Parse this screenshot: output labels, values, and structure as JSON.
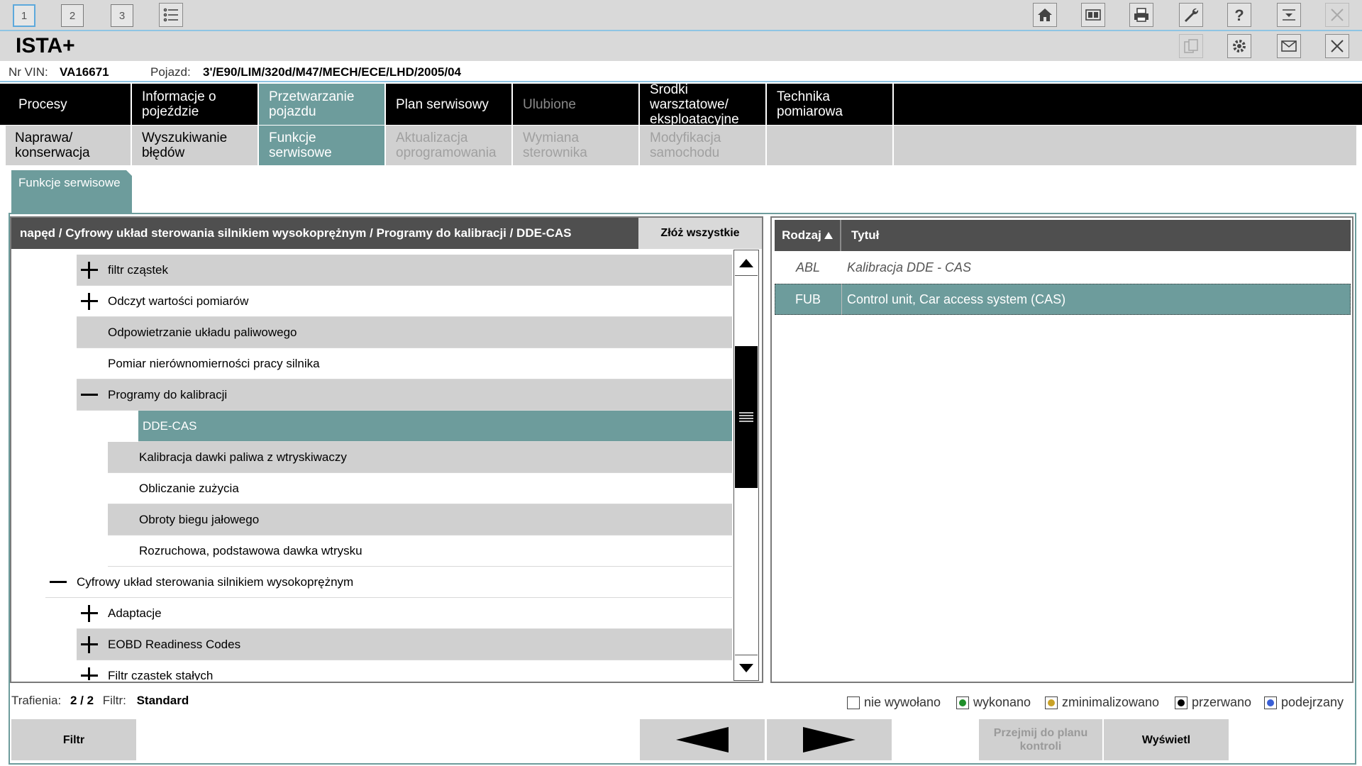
{
  "topbar": {
    "tabs": [
      "1",
      "2",
      "3"
    ],
    "icons": [
      "home-icon",
      "split-view-icon",
      "printer-icon",
      "wrench-icon",
      "help-icon",
      "dropdown-menu-icon",
      "close-icon"
    ]
  },
  "titlebar": {
    "title": "ISTA+",
    "icons": [
      "copy-icon",
      "settings-icon",
      "mail-icon",
      "close-icon"
    ]
  },
  "vehicle": {
    "vin_label": "Nr VIN:",
    "vin": "VA16671",
    "vehicle_label": "Pojazd:",
    "vehicle": "3'/E90/LIM/320d/M47/MECH/ECE/LHD/2005/04"
  },
  "main_nav": [
    {
      "label": "Procesy"
    },
    {
      "label": "Informacje o pojeździe"
    },
    {
      "label": "Przetwarzanie pojazdu"
    },
    {
      "label": "Plan serwisowy"
    },
    {
      "label": "Ulubione"
    },
    {
      "label": "Środki warsztatowe/ eksploatacyjne"
    },
    {
      "label": "Technika pomiarowa"
    }
  ],
  "sub_nav": [
    {
      "label": "Naprawa/ konserwacja"
    },
    {
      "label": "Wyszukiwanie błędów"
    },
    {
      "label": "Funkcje serwisowe"
    },
    {
      "label": "Aktualizacja oprogramowania"
    },
    {
      "label": "Wymiana sterownika"
    },
    {
      "label": "Modyfikacja samochodu"
    }
  ],
  "section_tab": "Funkcje serwisowe",
  "tree": {
    "breadcrumb": "napęd / Cyfrowy układ sterowania silnikiem wysokoprężnym / Programy do kalibracji / DDE-CAS",
    "collapse_all": "Złóż wszystkie",
    "rows": [
      {
        "label": "filtr cząstek"
      },
      {
        "label": "Odczyt wartości pomiarów"
      },
      {
        "label": "Odpowietrzanie układu paliwowego"
      },
      {
        "label": "Pomiar nierównomierności pracy silnika"
      },
      {
        "label": "Programy do kalibracji"
      },
      {
        "label": "DDE-CAS"
      },
      {
        "label": "Kalibracja dawki paliwa z wtryskiwaczy"
      },
      {
        "label": "Obliczanie zużycia"
      },
      {
        "label": "Obroty biegu jałowego"
      },
      {
        "label": "Rozruchowa, podstawowa dawka wtrysku"
      },
      {
        "label": "Cyfrowy układ sterowania silnikiem wysokoprężnym"
      },
      {
        "label": "Adaptacje"
      },
      {
        "label": "EOBD Readiness Codes"
      },
      {
        "label": "Filtr cząstek stałych"
      }
    ]
  },
  "results": {
    "col_type": "Rodzaj",
    "col_title": "Tytuł",
    "rows": [
      {
        "type": "ABL",
        "title": "Kalibracja DDE - CAS"
      },
      {
        "type": "FUB",
        "title": "Control unit, Car access system (CAS)"
      }
    ]
  },
  "status": {
    "hits_label": "Trafienia:",
    "hits": "2 / 2",
    "filter_label": "Filtr:",
    "filter": "Standard"
  },
  "legend": [
    {
      "label": "nie wywołano",
      "color": "#ffffff"
    },
    {
      "label": "wykonano",
      "color": "#1f8f2a"
    },
    {
      "label": "zminimalizowano",
      "color": "#c9a227"
    },
    {
      "label": "przerwano",
      "color": "#000000"
    },
    {
      "label": "podejrzany",
      "color": "#3a5fd6"
    }
  ],
  "buttons": {
    "filter": "Filtr",
    "transfer": "Przejmij do planu kontroli",
    "show": "Wyświetl"
  }
}
